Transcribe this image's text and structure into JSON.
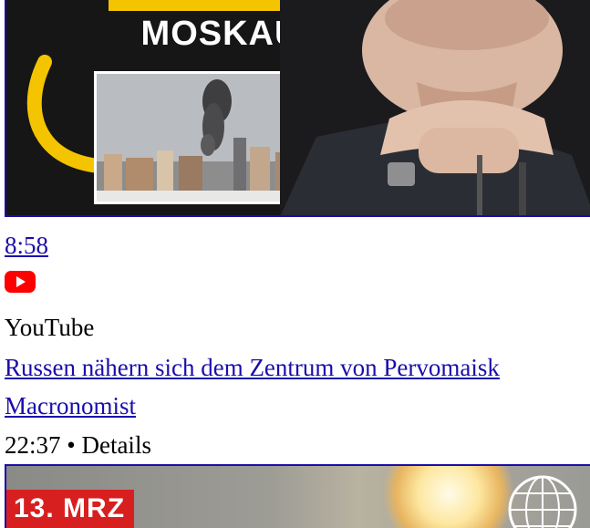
{
  "video1": {
    "thumbnail_text": "MOSKAU",
    "duration": "8:58",
    "source_icon": "youtube-icon",
    "source": "YouTube",
    "title": "Russen nähern sich dem Zentrum von Pervomaisk",
    "channel": "Macronomist",
    "time": "22:37",
    "separator": "•",
    "details_label": "Details"
  },
  "video2": {
    "thumbnail_text": "13. MRZ",
    "icon": "globe-icon"
  },
  "colors": {
    "link": "#1a0dab",
    "youtube_red": "#ff0000",
    "banner_yellow": "#f4c400",
    "date_red": "#d81f1f"
  }
}
